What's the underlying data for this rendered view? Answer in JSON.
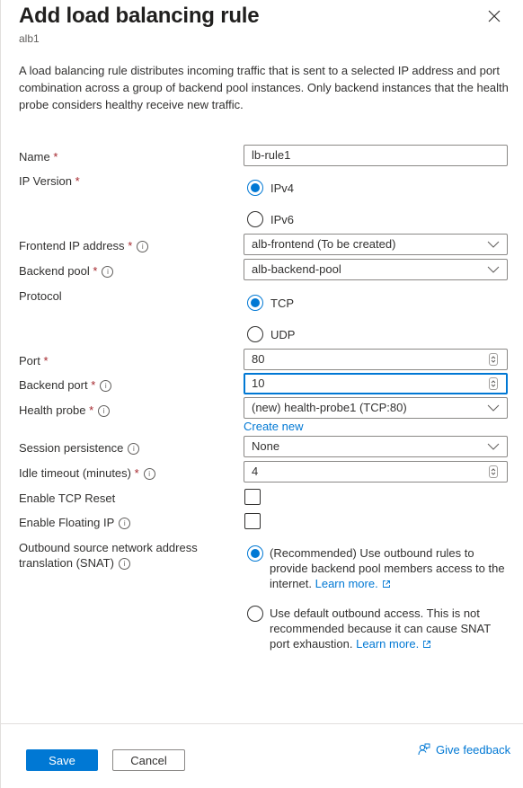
{
  "header": {
    "title": "Add load balancing rule",
    "subtitle": "alb1",
    "close_icon": "close-icon"
  },
  "description": "A load balancing rule distributes incoming traffic that is sent to a selected IP address and port combination across a group of backend pool instances. Only backend instances that the health probe considers healthy receive new traffic.",
  "form": {
    "name": {
      "label": "Name",
      "required": "*",
      "value": "lb-rule1"
    },
    "ip_version": {
      "label": "IP Version",
      "required": "*",
      "options": [
        {
          "label": "IPv4",
          "selected": true
        },
        {
          "label": "IPv6",
          "selected": false
        }
      ]
    },
    "frontend_ip": {
      "label": "Frontend IP address",
      "required": "*",
      "value": "alb-frontend (To be created)"
    },
    "backend_pool": {
      "label": "Backend pool",
      "required": "*",
      "value": "alb-backend-pool"
    },
    "protocol": {
      "label": "Protocol",
      "options": [
        {
          "label": "TCP",
          "selected": true
        },
        {
          "label": "UDP",
          "selected": false
        }
      ]
    },
    "port": {
      "label": "Port",
      "required": "*",
      "value": "80"
    },
    "backend_port": {
      "label": "Backend port",
      "required": "*",
      "value": "10",
      "focused": true
    },
    "health_probe": {
      "label": "Health probe",
      "required": "*",
      "value": "(new) health-probe1 (TCP:80)",
      "create_new": "Create new"
    },
    "session_persistence": {
      "label": "Session persistence",
      "value": "None"
    },
    "idle_timeout": {
      "label": "Idle timeout (minutes)",
      "required": "*",
      "value": "4"
    },
    "tcp_reset": {
      "label": "Enable TCP Reset",
      "checked": false
    },
    "floating_ip": {
      "label": "Enable Floating IP",
      "checked": false
    },
    "snat": {
      "label_line1": "Outbound source network address",
      "label_line2": "translation (SNAT)",
      "options": [
        {
          "text": "(Recommended) Use outbound rules to provide backend pool members access to the internet.",
          "link": "Learn more.",
          "selected": true
        },
        {
          "text": "Use default outbound access. This is not recommended because it can cause SNAT port exhaustion.",
          "link": "Learn more.",
          "selected": false
        }
      ]
    }
  },
  "footer": {
    "save": "Save",
    "cancel": "Cancel",
    "feedback": "Give feedback"
  },
  "colors": {
    "accent": "#0078d4",
    "required": "#a4262c"
  }
}
